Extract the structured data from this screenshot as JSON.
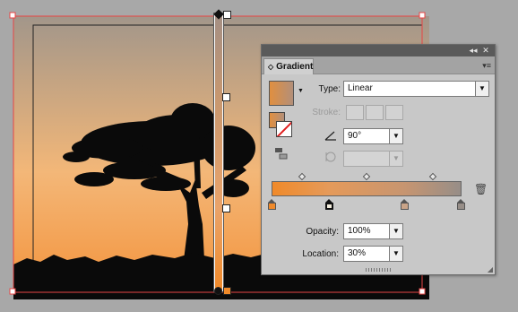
{
  "colors": {
    "canvas_bg": "#a8a8a8",
    "sky_top": "#a2968a",
    "sky_mid": "#f3b778",
    "sky_bottom": "#f3923a",
    "selection_red": "#e84545",
    "gradient_start": "#f08a2a",
    "gradient_end": "#978e88"
  },
  "panel": {
    "title": "Gradient",
    "tab_chevron": "◇",
    "menu_icon": "▾≡",
    "collapse_icon": "◂◂",
    "close_icon": "✕",
    "type_label": "Type:",
    "type_value": "Linear",
    "stroke_label": "Stroke:",
    "angle_value": "90°",
    "opacity_label": "Opacity:",
    "opacity_value": "100%",
    "location_label": "Location:",
    "location_value": "30%",
    "swatch_caret": "▼",
    "select_arrow": "▼",
    "trash_icon": "🗑"
  },
  "gradient": {
    "stops": [
      {
        "location": 0,
        "color": "#f08a2a",
        "selected": false
      },
      {
        "location": 30,
        "color": "#f2ecdc",
        "selected": true
      },
      {
        "location": 70,
        "color": "#c9a488",
        "selected": false
      },
      {
        "location": 100,
        "color": "#978e88",
        "selected": false
      }
    ],
    "midpoints": [
      15,
      50,
      85
    ]
  }
}
